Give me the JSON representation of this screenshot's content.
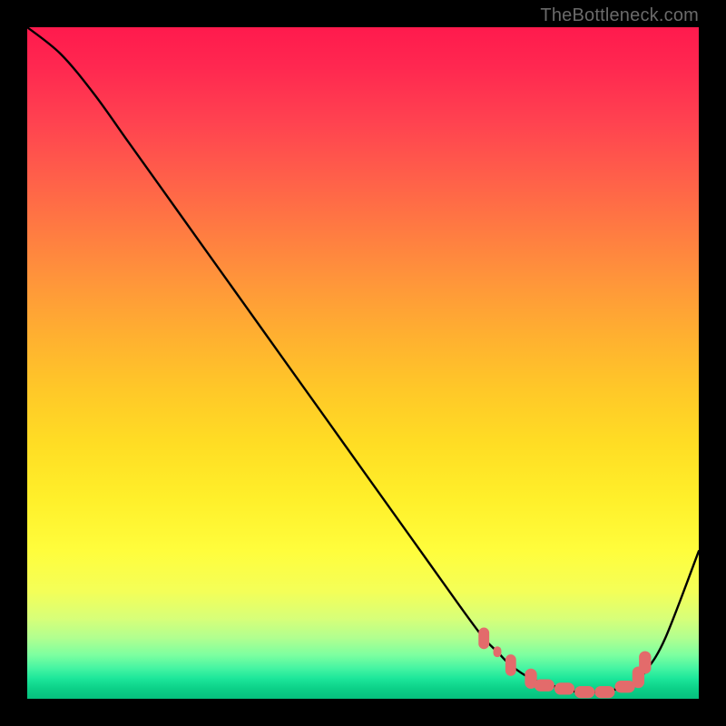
{
  "attribution": "TheBottleneck.com",
  "chart_data": {
    "type": "line",
    "title": "",
    "xlabel": "",
    "ylabel": "",
    "xlim": [
      0,
      100
    ],
    "ylim": [
      0,
      100
    ],
    "grid": false,
    "background_gradient": {
      "orientation": "vertical",
      "stops": [
        {
          "pos": 0.0,
          "color": "#ff1a4d"
        },
        {
          "pos": 0.5,
          "color": "#ffc828"
        },
        {
          "pos": 0.85,
          "color": "#f4ff58"
        },
        {
          "pos": 1.0,
          "color": "#06c07e"
        }
      ]
    },
    "series": [
      {
        "name": "bottleneck-curve",
        "color": "#000000",
        "x": [
          0,
          5,
          10,
          15,
          20,
          25,
          30,
          35,
          40,
          45,
          50,
          55,
          60,
          65,
          68,
          70,
          72,
          75,
          78,
          80,
          82,
          84,
          86,
          88,
          90,
          92,
          95,
          100
        ],
        "y": [
          100,
          96,
          90,
          83,
          76,
          69,
          62,
          55,
          48,
          41,
          34,
          27,
          20,
          13,
          9,
          7,
          5,
          3,
          2,
          1.5,
          1,
          1,
          1,
          1.5,
          2,
          4,
          9,
          22
        ]
      }
    ],
    "markers": [
      {
        "name": "optimal-range-dots",
        "color": "#e36b6b",
        "shape": "rounded",
        "points": [
          {
            "x": 68,
            "y": 9,
            "w": 1.6,
            "h": 3.2
          },
          {
            "x": 70,
            "y": 7,
            "w": 1.2,
            "h": 1.6
          },
          {
            "x": 72,
            "y": 5,
            "w": 1.6,
            "h": 3.2
          },
          {
            "x": 75,
            "y": 3,
            "w": 1.8,
            "h": 3.0
          },
          {
            "x": 77,
            "y": 2,
            "w": 3.0,
            "h": 1.8
          },
          {
            "x": 80,
            "y": 1.5,
            "w": 3.0,
            "h": 1.8
          },
          {
            "x": 83,
            "y": 1,
            "w": 3.0,
            "h": 1.8
          },
          {
            "x": 86,
            "y": 1,
            "w": 3.0,
            "h": 1.8
          },
          {
            "x": 89,
            "y": 1.8,
            "w": 3.0,
            "h": 1.8
          },
          {
            "x": 91,
            "y": 3.2,
            "w": 1.8,
            "h": 3.2
          },
          {
            "x": 92,
            "y": 5.4,
            "w": 1.8,
            "h": 3.4
          }
        ]
      }
    ]
  }
}
